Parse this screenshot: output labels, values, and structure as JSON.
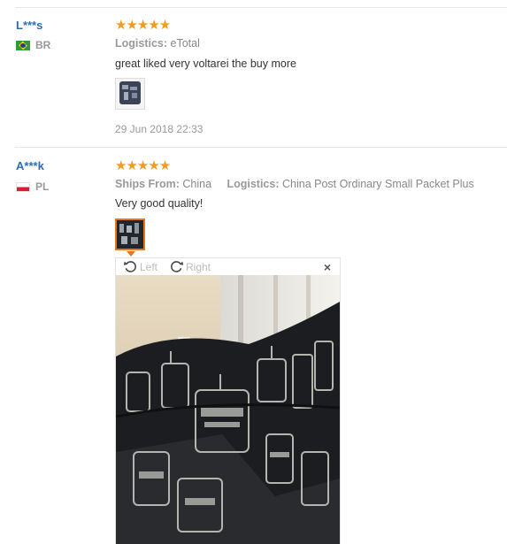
{
  "reviews": [
    {
      "user": "L***s",
      "country": "BR",
      "stars": "★★★★★",
      "logistics_label": "Logistics:",
      "logistics_value": "eTotal",
      "text": "great liked very voltarei the buy more",
      "date": "29 Jun 2018 22:33"
    },
    {
      "user": "A***k",
      "country": "PL",
      "stars": "★★★★★",
      "ships_label": "Ships From:",
      "ships_value": "China",
      "logistics_label": "Logistics:",
      "logistics_value": "China Post Ordinary Small Packet Plus",
      "text": "Very good quality!"
    }
  ],
  "viewer": {
    "rotate_left": "Left",
    "rotate_right": "Right",
    "close": "×"
  },
  "colors": {
    "username": "#2f6cb5",
    "stars": "#f29b1c",
    "selected_thumb": "#e6761e"
  }
}
